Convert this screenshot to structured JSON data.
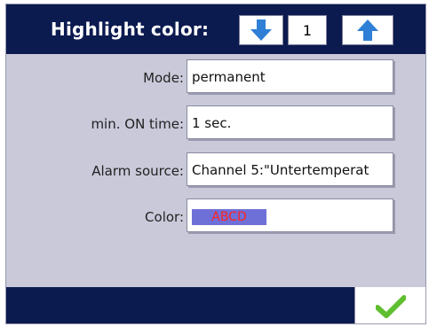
{
  "header": {
    "title": "Highlight color:",
    "value": "1",
    "down_icon": "arrow-down-icon",
    "up_icon": "arrow-up-icon"
  },
  "fields": [
    {
      "label": "Mode:",
      "value": "permanent"
    },
    {
      "label": "min. ON time:",
      "value": "1 sec."
    },
    {
      "label": "Alarm source:",
      "value": "Channel  5:\"Untertemperat"
    },
    {
      "label": "Color:",
      "swatch_text": "ABCD"
    }
  ],
  "colors": {
    "header_bg": "#0b1a4f",
    "panel_bg": "#c9c9da",
    "swatch_bg": "#6f6fd8",
    "swatch_text": "#ff2222",
    "arrow_blue": "#2f7fd6",
    "check_green": "#5fbf2f"
  },
  "footer": {
    "ok_icon": "checkmark-icon"
  }
}
